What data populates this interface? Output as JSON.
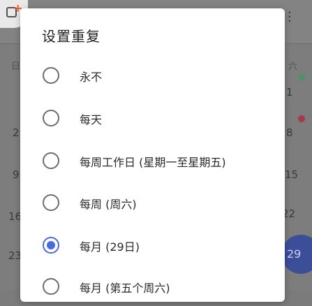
{
  "dialog": {
    "title": "设置重复",
    "options": [
      {
        "label": "永不",
        "checked": false
      },
      {
        "label": "每天",
        "checked": false
      },
      {
        "label": "每周工作日 (星期一至星期五)",
        "checked": false
      },
      {
        "label": "每周 (周六)",
        "checked": false
      },
      {
        "label": "每月 (29日)",
        "checked": true
      },
      {
        "label": "每月 (第五个周六)",
        "checked": false
      }
    ]
  },
  "background": {
    "weekday_left": "日",
    "weekday_right": "六",
    "left_dates": [
      "2",
      "9",
      "16",
      "23"
    ],
    "right_dates": [
      "1",
      "8",
      "15",
      "22"
    ],
    "highlight_date": "29"
  },
  "colors": {
    "accent": "#4a6be0",
    "dot_green": "#4f8f6c",
    "dot_red": "#a33a4e"
  }
}
